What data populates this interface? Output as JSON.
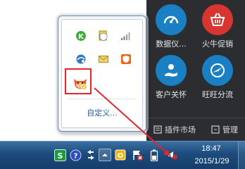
{
  "app_panel": {
    "tiles": [
      {
        "label": "数据仪...",
        "icon": "gauge-icon",
        "color": "#1b7fc4"
      },
      {
        "label": "火牛促销",
        "icon": "shopping-basket-icon",
        "color": "#d6362f"
      },
      {
        "label": "客户关怀",
        "icon": "hand-heart-icon",
        "color": "#1b7fc4"
      },
      {
        "label": "旺旺分流",
        "icon": "compass-icon",
        "color": "#1b7fc4"
      }
    ],
    "bottom_links": [
      {
        "label": "插件市场",
        "icon": "plugin-market-icon"
      },
      {
        "label": "管理",
        "icon": "manage-icon"
      }
    ]
  },
  "tray_popup": {
    "icons": [
      "kaspersky-k-icon",
      "shield-document-icon",
      "signal-bars-icon",
      "network-globe-icon",
      "mail-icon",
      "orange-shield-icon",
      "qianniu-cow-icon"
    ],
    "customize_label": "自定义..."
  },
  "taskbar": {
    "icons": [
      "green-s-icon",
      "help-icon",
      "arrows-icon",
      "show-hidden-icons-button",
      "yellow-app-icon",
      "action-center-icon",
      "battery-icon",
      "volume-icon"
    ],
    "time": "18:47",
    "date": "2015/1/29"
  },
  "annotation": {
    "highlight_color": "#e2262c"
  }
}
